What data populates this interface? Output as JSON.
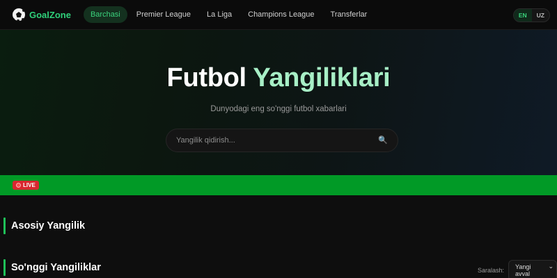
{
  "nav": {
    "logo_text": "GoalZone",
    "items": [
      {
        "label": "Barchasi",
        "active": true
      },
      {
        "label": "Premier League",
        "active": false
      },
      {
        "label": "La Liga",
        "active": false
      },
      {
        "label": "Champions League",
        "active": false
      },
      {
        "label": "Transferlar",
        "active": false
      }
    ],
    "lang": {
      "en": "EN",
      "uz": "UZ",
      "selected": "EN"
    }
  },
  "hero": {
    "title_main": "Futbol",
    "title_accent": "Yangiliklari",
    "subtitle": "Dunyodagi eng so'nggi futbol xabarlari",
    "search_placeholder": "Yangilik qidirish...",
    "search_icon": "search-icon"
  },
  "live": {
    "label": "LIVE"
  },
  "sections": {
    "main_news": "Asosiy Yangilik",
    "latest_news": "So'nggi Yangiliklar"
  },
  "sort": {
    "label": "Saralash:",
    "selected": "Yangi avval"
  },
  "colors": {
    "accent": "#2fd07a",
    "live_bar": "#019a26",
    "live_badge": "#d8272f",
    "section_bar": "#1fc158"
  }
}
